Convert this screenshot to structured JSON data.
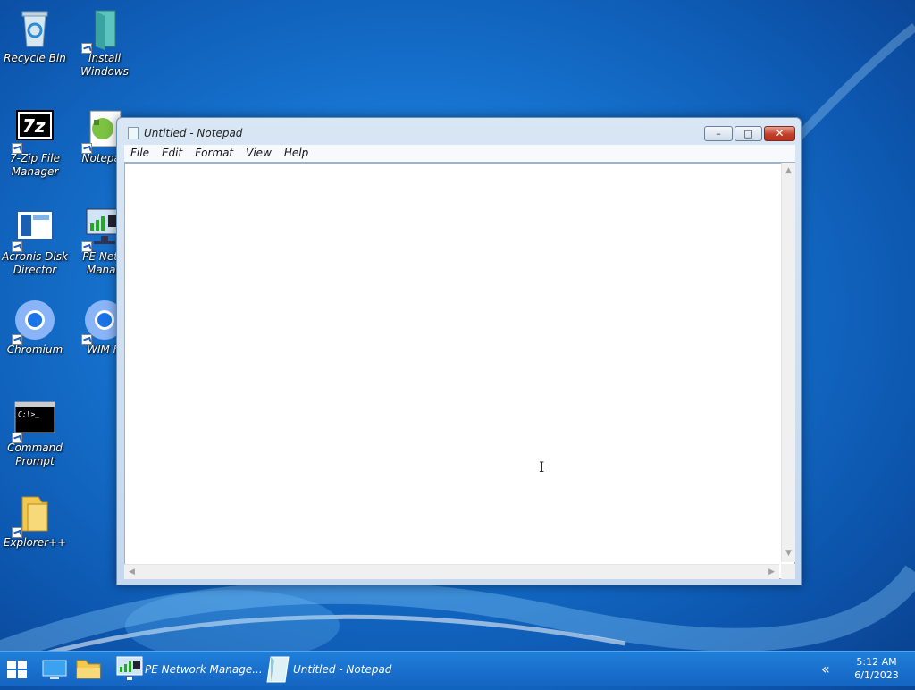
{
  "desktop": {
    "icons": [
      {
        "label": "Recycle Bin",
        "icon": "recycle-bin-icon"
      },
      {
        "label": "Install Windows",
        "icon": "install-windows-icon"
      },
      {
        "label": "7-Zip File Manager",
        "icon": "seven-zip-icon"
      },
      {
        "label": "Notepad",
        "icon": "notepad-icon"
      },
      {
        "label": "Acronis Disk Director",
        "icon": "acronis-icon"
      },
      {
        "label": "PE Network Manager",
        "icon": "network-manager-icon"
      },
      {
        "label": "Chromium",
        "icon": "chromium-icon"
      },
      {
        "label": "WIM Fi",
        "icon": "chromium-icon"
      },
      {
        "label": "Command Prompt",
        "icon": "command-prompt-icon"
      },
      {
        "label": "Explorer++",
        "icon": "folder-icon"
      }
    ],
    "visible_labels": {
      "recycle": "Recycle Bin",
      "install_1": "Install",
      "install_2": "Windows",
      "sevenzip_1": "7-Zip File",
      "sevenzip_2": "Manager",
      "notepad": "Notepad",
      "acronis_1": "Acronis Disk",
      "acronis_2": "Director",
      "pe_1": "PE Netw",
      "pe_2": "Manag",
      "chromium": "Chromium",
      "wim": "WIM Fi",
      "cmd_1": "Command",
      "cmd_2": "Prompt",
      "explorer": "Explorer++"
    }
  },
  "window": {
    "title": "Untitled - Notepad",
    "menu": [
      "File",
      "Edit",
      "Format",
      "View",
      "Help"
    ],
    "content": "",
    "buttons": {
      "minimize": "–",
      "maximize": "□",
      "close": "✕"
    }
  },
  "taskbar": {
    "tasks": [
      {
        "label": "PE Network Manage...",
        "icon": "network-manager-icon"
      },
      {
        "label": "Untitled - Notepad",
        "icon": "notepad-icon"
      }
    ],
    "tray_chevron": "«",
    "clock": {
      "time": "5:12 AM",
      "date": "6/1/2023"
    }
  },
  "colors": {
    "desktop": "#1673cf",
    "taskbar": "#1a6fcc",
    "close_button": "#c2402b"
  }
}
